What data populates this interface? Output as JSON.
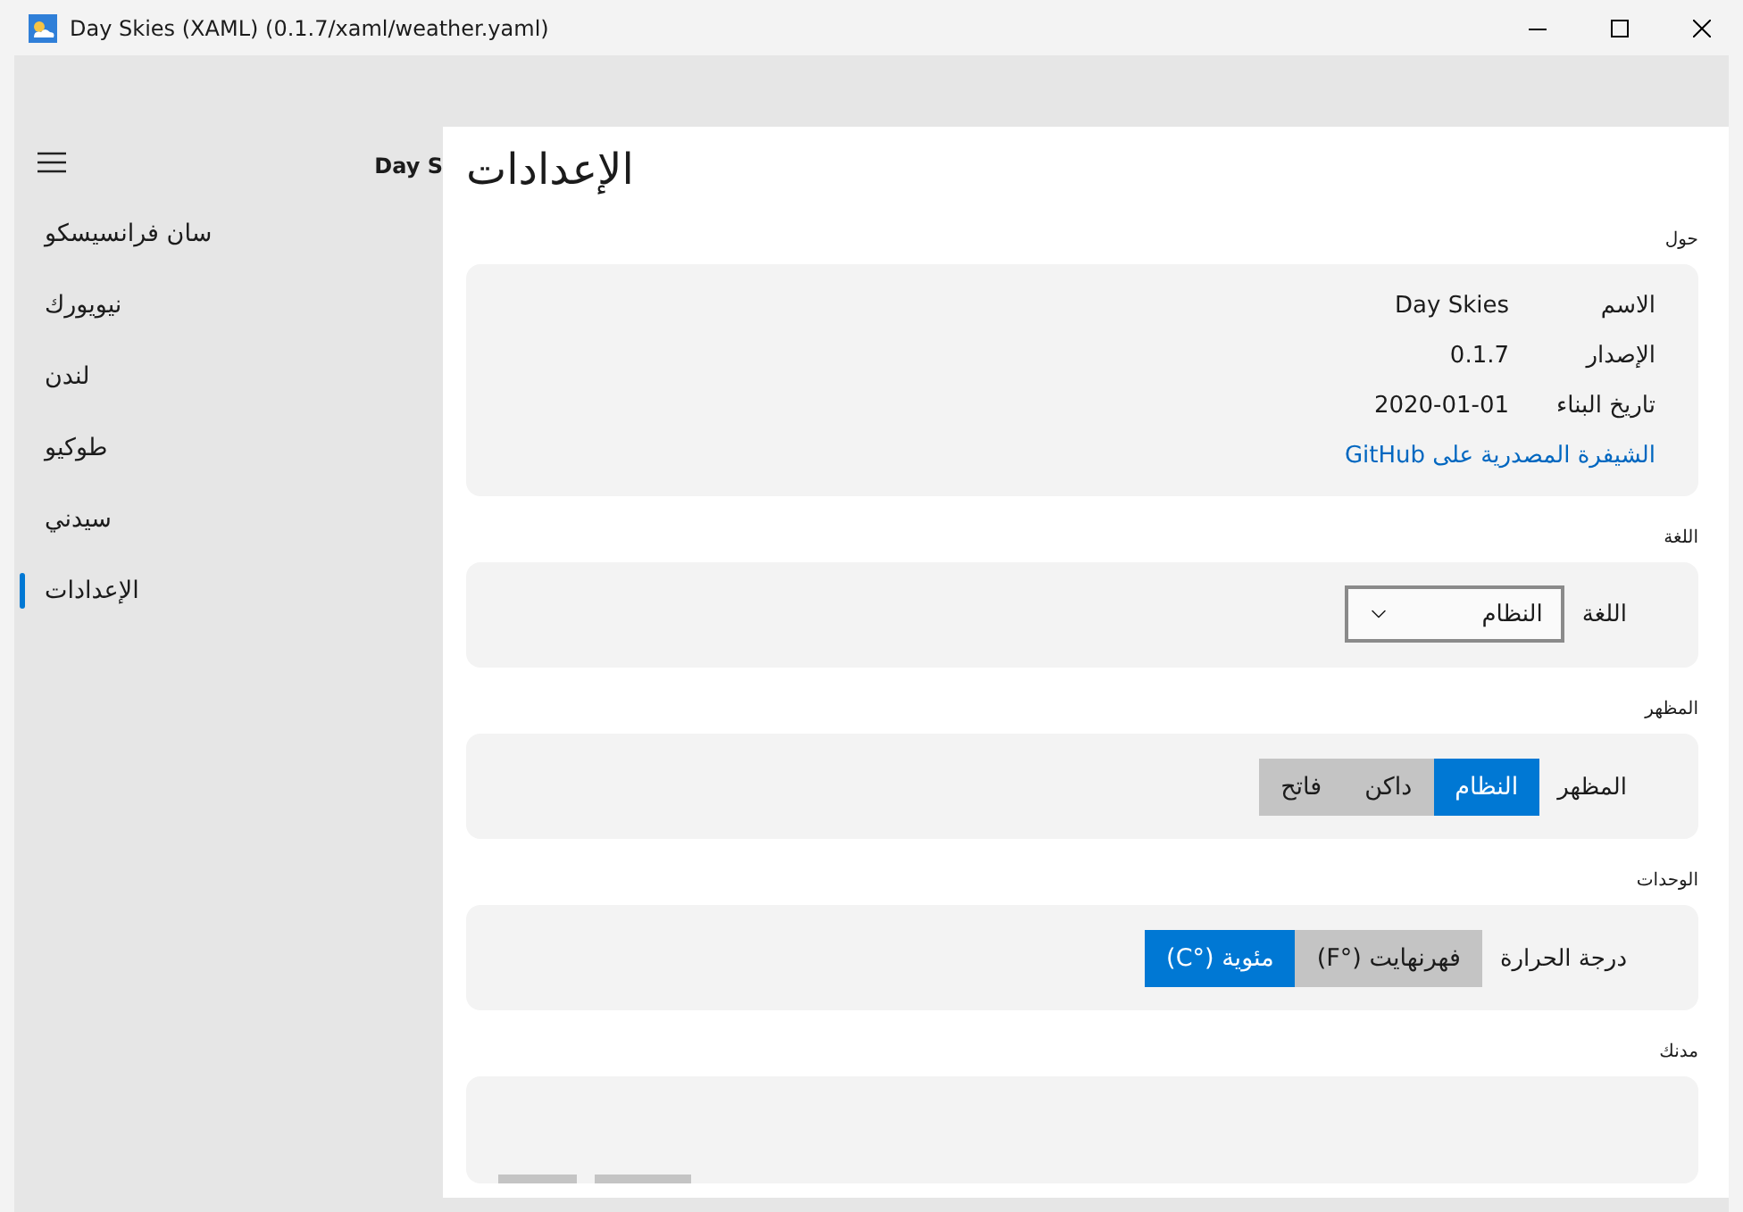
{
  "window": {
    "title": "Day Skies (XAML) (0.1.7/xaml/weather.yaml)"
  },
  "sidebar": {
    "header": "Day S",
    "items": [
      {
        "label": "سان فرانسيسكو",
        "selected": false
      },
      {
        "label": "نيويورك",
        "selected": false
      },
      {
        "label": "لندن",
        "selected": false
      },
      {
        "label": "طوكيو",
        "selected": false
      },
      {
        "label": "سيدني",
        "selected": false
      },
      {
        "label": "الإعدادات",
        "selected": true
      }
    ]
  },
  "settings": {
    "title": "الإعدادات",
    "sections": [
      {
        "kind": "info",
        "heading": "حول",
        "rows": [
          {
            "label": "الاسم",
            "value": "Day Skies"
          },
          {
            "label": "الإصدار",
            "value": "0.1.7"
          },
          {
            "label": "تاريخ البناء",
            "value": "2020-01-01"
          }
        ],
        "link": "الشيفرة المصدرية على GitHub"
      },
      {
        "kind": "select",
        "heading": "اللغة",
        "label": "اللغة",
        "value": "النظام"
      },
      {
        "kind": "segmented",
        "heading": "المظهر",
        "label": "المظهر",
        "options": [
          {
            "label": "النظام",
            "selected": true
          },
          {
            "label": "داكن",
            "selected": false
          },
          {
            "label": "فاتح",
            "selected": false
          }
        ]
      },
      {
        "kind": "segmented",
        "heading": "الوحدات",
        "label": "درجة الحرارة",
        "options": [
          {
            "label": "فهرنهايت (°F)",
            "selected": false
          },
          {
            "label": "مئوية (°C)",
            "selected": true
          }
        ]
      },
      {
        "kind": "partial",
        "heading": "مدنك"
      }
    ]
  }
}
